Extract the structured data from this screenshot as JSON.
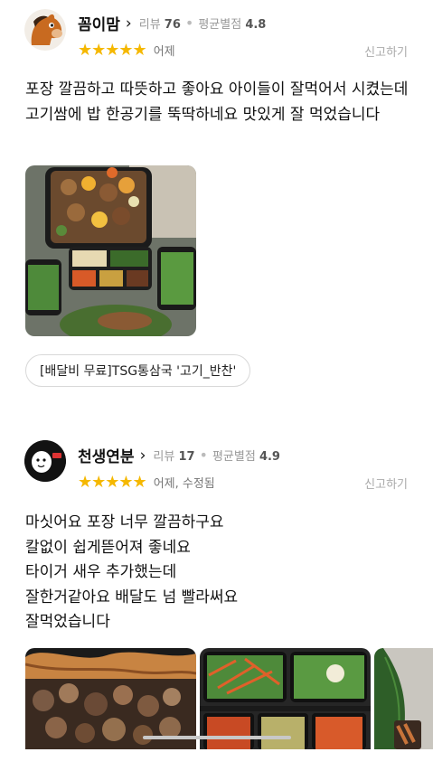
{
  "reviews": [
    {
      "nickname": "꼼이맘",
      "review_label": "리뷰",
      "review_count": "76",
      "avg_label": "평균별점",
      "avg_rating": "4.8",
      "stars": 5,
      "date": "어제",
      "report": "신고하기",
      "text": "포장 깔끔하고 따뜻하고 좋아요 아이들이 잘먹어서 시켰는데 고기쌈에 밥 한공기를 뚝딱하네요 맛있게 잘 먹었습니다",
      "menu_chip": "[배달비 무료]TSG통삼국 '고기_반찬'"
    },
    {
      "nickname": "천생연분",
      "review_label": "리뷰",
      "review_count": "17",
      "avg_label": "평균별점",
      "avg_rating": "4.9",
      "stars": 5,
      "date": "어제, 수정됨",
      "report": "신고하기",
      "text_lines": [
        "마싯어요 포장 너무 깔끔하구요",
        "칼없이 쉽게뜯어져 좋네요",
        "타이거 새우 추가했는데",
        "잘한거같아요 배달도 넘 빨라써요",
        "잘먹었습니다"
      ]
    }
  ],
  "colors": {
    "star": "#f5b800",
    "meta": "#999999",
    "report": "#aaaaaa"
  },
  "icons": {
    "profile_chevron": "chevron-right-icon",
    "star": "star-icon"
  }
}
